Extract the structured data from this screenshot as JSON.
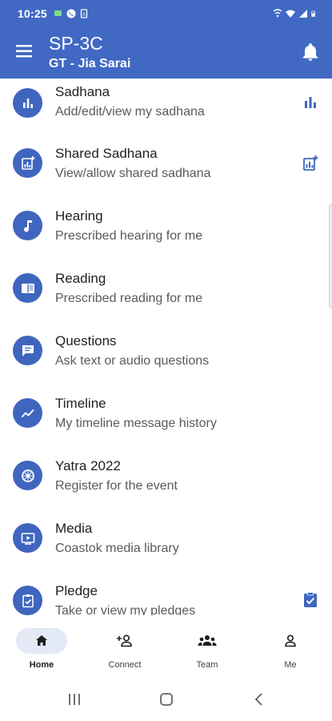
{
  "status_bar": {
    "time": "10:25",
    "left_icons": [
      "chat-bubble-icon",
      "phone-call-icon",
      "sim-icon"
    ],
    "right_icons": [
      "vibrate-icon",
      "wifi-icon",
      "signal-icon",
      "battery-icon"
    ]
  },
  "app_bar": {
    "title": "SP-3C",
    "subtitle": "GT - Jia Sarai",
    "menu_icon": "menu-icon",
    "action_icon": "bell-icon",
    "background": "#4169c4"
  },
  "menu": {
    "items": [
      {
        "title": "Sadhana",
        "subtitle": "Add/edit/view my sadhana",
        "icon": "bar-chart-icon",
        "trailing_icon": "bar-chart-icon"
      },
      {
        "title": "Shared Sadhana",
        "subtitle": "View/allow shared sadhana",
        "icon": "chart-add-icon",
        "trailing_icon": "chart-add-icon"
      },
      {
        "title": "Hearing",
        "subtitle": "Prescribed hearing for me",
        "icon": "music-note-icon"
      },
      {
        "title": "Reading",
        "subtitle": "Prescribed reading for me",
        "icon": "book-icon"
      },
      {
        "title": "Questions",
        "subtitle": "Ask text or audio questions",
        "icon": "chat-icon"
      },
      {
        "title": "Timeline",
        "subtitle": "My timeline message history",
        "icon": "trending-icon"
      },
      {
        "title": "Yatra 2022",
        "subtitle": "Register for the event",
        "icon": "wheel-icon"
      },
      {
        "title": "Media",
        "subtitle": "Coastok media library",
        "icon": "play-icon"
      },
      {
        "title": "Pledge",
        "subtitle": "Take or view my pledges",
        "icon": "clipboard-check-icon",
        "trailing_icon": "clipboard-check-icon"
      }
    ]
  },
  "bottom_nav": {
    "items": [
      {
        "label": "Home",
        "icon": "home-icon",
        "active": true
      },
      {
        "label": "Connect",
        "icon": "person-add-icon",
        "active": false
      },
      {
        "label": "Team",
        "icon": "group-icon",
        "active": false
      },
      {
        "label": "Me",
        "icon": "person-icon",
        "active": false
      }
    ]
  },
  "system_nav": {
    "buttons": [
      "recents-icon",
      "home-outline-icon",
      "back-icon"
    ]
  },
  "colors": {
    "accent": "#3f65bf",
    "active_nav": "#e4e9f6"
  }
}
